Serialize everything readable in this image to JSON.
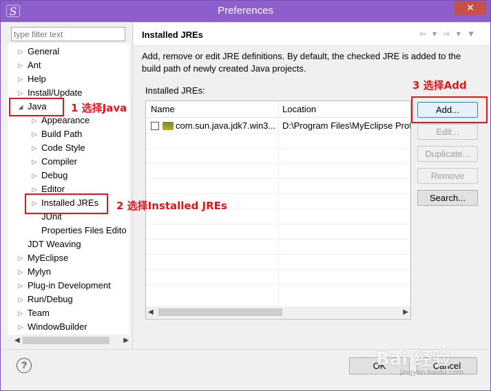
{
  "window": {
    "title": "Preferences",
    "app_icon": "S",
    "close_label": "✕"
  },
  "filter": {
    "placeholder": "type filter text"
  },
  "tree": {
    "items": [
      {
        "label": "General",
        "arrow": "▷"
      },
      {
        "label": "Ant",
        "arrow": "▷"
      },
      {
        "label": "Help",
        "arrow": "▷"
      },
      {
        "label": "Install/Update",
        "arrow": "▷"
      },
      {
        "label": "Java",
        "arrow": "◢"
      },
      {
        "label": "Appearance",
        "arrow": "▷"
      },
      {
        "label": "Build Path",
        "arrow": "▷"
      },
      {
        "label": "Code Style",
        "arrow": "▷"
      },
      {
        "label": "Compiler",
        "arrow": "▷"
      },
      {
        "label": "Debug",
        "arrow": "▷"
      },
      {
        "label": "Editor",
        "arrow": "▷"
      },
      {
        "label": "Installed JREs",
        "arrow": "▷"
      },
      {
        "label": "JUnit",
        "arrow": ""
      },
      {
        "label": "Properties Files Edito",
        "arrow": ""
      },
      {
        "label": "JDT Weaving",
        "arrow": ""
      },
      {
        "label": "MyEclipse",
        "arrow": "▷"
      },
      {
        "label": "Mylyn",
        "arrow": "▷"
      },
      {
        "label": "Plug-in Development",
        "arrow": "▷"
      },
      {
        "label": "Run/Debug",
        "arrow": "▷"
      },
      {
        "label": "Team",
        "arrow": "▷"
      },
      {
        "label": "WindowBuilder",
        "arrow": "▷"
      }
    ]
  },
  "page": {
    "title": "Installed JREs",
    "description": "Add, remove or edit JRE definitions. By default, the checked JRE is added to the build path of newly created Java projects.",
    "section_label": "Installed JREs:",
    "nav_icons": "⇦ ▾ ⇨ ▾ ▼"
  },
  "table": {
    "headers": [
      "Name",
      "Location"
    ],
    "rows": [
      {
        "name": "com.sun.java.jdk7.win3...",
        "location": "D:\\Program Files\\MyEclipse Prof",
        "checked": false
      }
    ]
  },
  "buttons": {
    "add": "Add...",
    "edit": "Edit...",
    "duplicate": "Duplicate...",
    "remove": "Remove",
    "search": "Search..."
  },
  "footer": {
    "help": "?",
    "ok": "OK",
    "cancel": "Cancel"
  },
  "annotations": {
    "step1": "1 选择Java",
    "step2": "2  选择Installed JREs",
    "step3": "3  选择Add"
  },
  "watermark": {
    "main": "Bai 经验",
    "sub": "jingyan.baidu.com"
  },
  "colors": {
    "titlebar": "#8d5fcc",
    "annotation": "#e3141a",
    "close_button": "#c7504a"
  }
}
